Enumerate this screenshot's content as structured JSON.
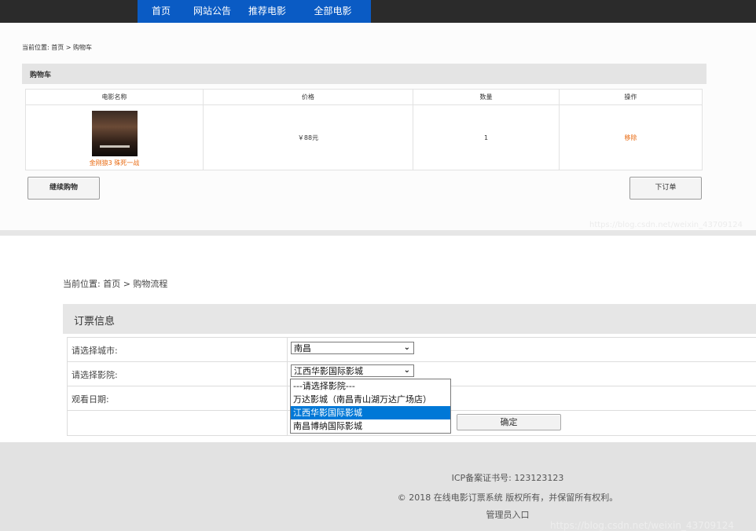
{
  "nav": {
    "items": [
      "首页",
      "网站公告",
      "推荐电影",
      "全部电影"
    ]
  },
  "cart_page": {
    "breadcrumb": "当前位置: 首页 > 购物车",
    "panel_title": "购物车",
    "columns": [
      "电影名称",
      "价格",
      "数量",
      "操作"
    ],
    "row": {
      "film": "金刚狼3 殊死一战",
      "price": "￥88元",
      "qty": "1",
      "action": "移除"
    },
    "continue_button": "继续购物",
    "order_button": "下订单",
    "watermark": "https://blog.csdn.net/weixin_43709124"
  },
  "order_page": {
    "breadcrumb": "当前位置: 首页 > 购物流程",
    "panel_title": "订票信息",
    "city_label": "请选择城市:",
    "city_value": "南昌",
    "cinema_label": "请选择影院:",
    "cinema_value": "江西华影国际影城",
    "date_label": "观看日期:",
    "cinema_options": [
      "---请选择影院---",
      "万达影城（南昌青山湖万达广场店）",
      "江西华影国际影城",
      "南昌博纳国际影城"
    ],
    "selected_index": 2,
    "confirm_button": "确定"
  },
  "footer": {
    "icp": "ICP备案证书号: 123123123",
    "copyright": "© 2018 在线电影订票系统 版权所有，并保留所有权利。",
    "admin_link": "管理员入口",
    "watermark": "https://blog.csdn.net/weixin_43709124"
  }
}
